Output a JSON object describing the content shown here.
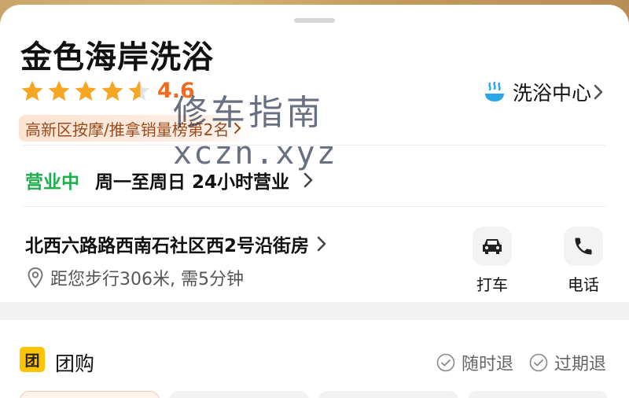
{
  "shop": {
    "name": "金色海岸洗浴",
    "rating": "4.6",
    "rating_value": 4.6,
    "category": "洗浴中心",
    "rank_badge": "高新区按摩/推拿销量榜第2名"
  },
  "watermark": {
    "line1": "修车指南",
    "line2": "xczn.xyz"
  },
  "hours": {
    "status": "营业中",
    "text": "周一至周日 24小时营业"
  },
  "location": {
    "address": "北西六路路西南石社区西2号沿街房",
    "distance": "距您步行306米, 需5分钟"
  },
  "actions": {
    "taxi_label": "打车",
    "phone_label": "电话"
  },
  "group_buy": {
    "badge": "团",
    "title": "团购",
    "policy_anytime": "随时退",
    "policy_expired": "过期退"
  },
  "icons": {
    "star": "star-icon",
    "category": "hot-spring-icon",
    "pin": "location-pin-icon",
    "car": "car-icon",
    "phone": "phone-icon",
    "check": "check-circle-icon"
  },
  "colors": {
    "star": "#f5a623",
    "star_empty": "#e3e3e3",
    "rating": "#f06b1d",
    "open_status": "#1fae4e",
    "group_badge": "#ffc300",
    "category_icon": "#2aa5e8"
  }
}
